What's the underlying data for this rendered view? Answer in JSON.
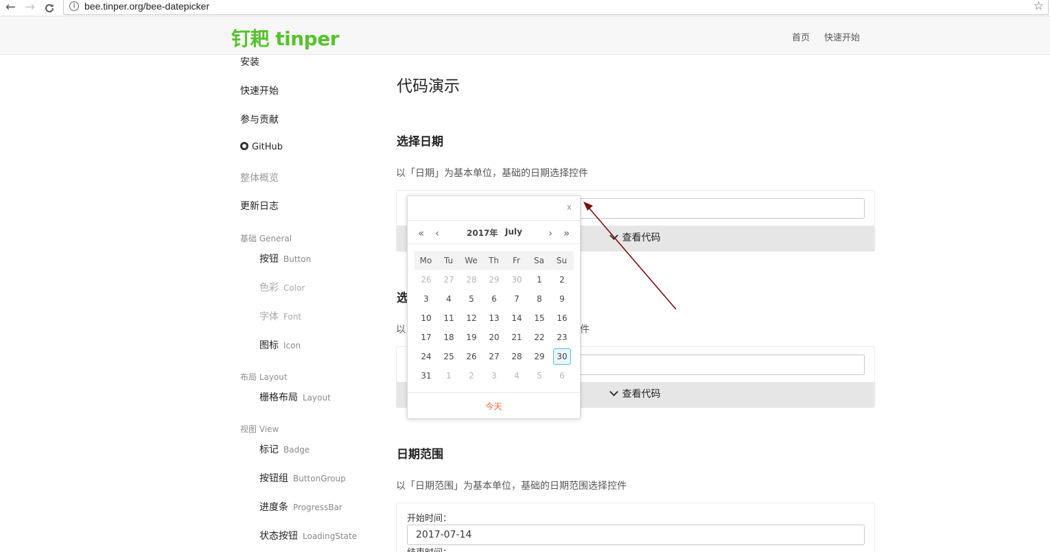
{
  "browser": {
    "url": "bee.tinper.org/bee-datepicker",
    "back_glyph": "←",
    "forward_glyph": "→",
    "reload_glyph": "C",
    "info_glyph": "i",
    "star_glyph": "☆"
  },
  "header": {
    "logo": "钉耙 tinper",
    "nav": [
      "首页",
      "快速开始"
    ],
    "logo_color": "#57c22d"
  },
  "sidebar": {
    "items": [
      "安装",
      "快速开始",
      "参与贡献",
      "GitHub",
      "整体概览",
      "更新日志"
    ],
    "groups": [
      {
        "label": "基础 General",
        "items": [
          {
            "cn": "按钮",
            "en": "Button"
          },
          {
            "cn": "色彩",
            "en": "Color"
          },
          {
            "cn": "字体",
            "en": "Font"
          },
          {
            "cn": "图标",
            "en": "Icon"
          }
        ]
      },
      {
        "label": "布局 Layout",
        "items": [
          {
            "cn": "栅格布局",
            "en": "Layout"
          }
        ]
      },
      {
        "label": "视图 View",
        "items": [
          {
            "cn": "标记",
            "en": "Badge"
          },
          {
            "cn": "按钮组",
            "en": "ButtonGroup"
          },
          {
            "cn": "进度条",
            "en": "ProgressBar"
          },
          {
            "cn": "状态按钮",
            "en": "LoadingState"
          }
        ]
      }
    ]
  },
  "main": {
    "title": "代码演示",
    "sections": [
      {
        "title": "选择日期",
        "desc": "以「日期」为基本单位，基础的日期选择控件",
        "code_label": "查看代码"
      },
      {
        "title": "选",
        "desc_start": "以",
        "desc_end": "件",
        "code_label": "查看代码"
      },
      {
        "title": "日期范围",
        "desc": "以「日期范围」为基本单位，基础的日期范围选择控件",
        "start_label": "开始时间：",
        "start_value": "2017-07-14",
        "end_label": "结束时间："
      }
    ]
  },
  "calendar": {
    "close": "x",
    "prev_year": "«",
    "prev_month": "‹",
    "next_month": "›",
    "next_year": "»",
    "year": "2017年",
    "month": "July",
    "weekdays": [
      "Mo",
      "Tu",
      "We",
      "Th",
      "Fr",
      "Sa",
      "Su"
    ],
    "weeks": [
      [
        "26",
        "27",
        "28",
        "29",
        "30",
        "1",
        "2"
      ],
      [
        "3",
        "4",
        "5",
        "6",
        "7",
        "8",
        "9"
      ],
      [
        "10",
        "11",
        "12",
        "13",
        "14",
        "15",
        "16"
      ],
      [
        "17",
        "18",
        "19",
        "20",
        "21",
        "22",
        "23"
      ],
      [
        "24",
        "25",
        "26",
        "27",
        "28",
        "29",
        "30"
      ],
      [
        "31",
        "1",
        "2",
        "3",
        "4",
        "5",
        "6"
      ]
    ],
    "selected": "30",
    "today": "今天",
    "today_color": "#f06430"
  },
  "annotation": {
    "arrow_color": "#7a0a0a"
  }
}
